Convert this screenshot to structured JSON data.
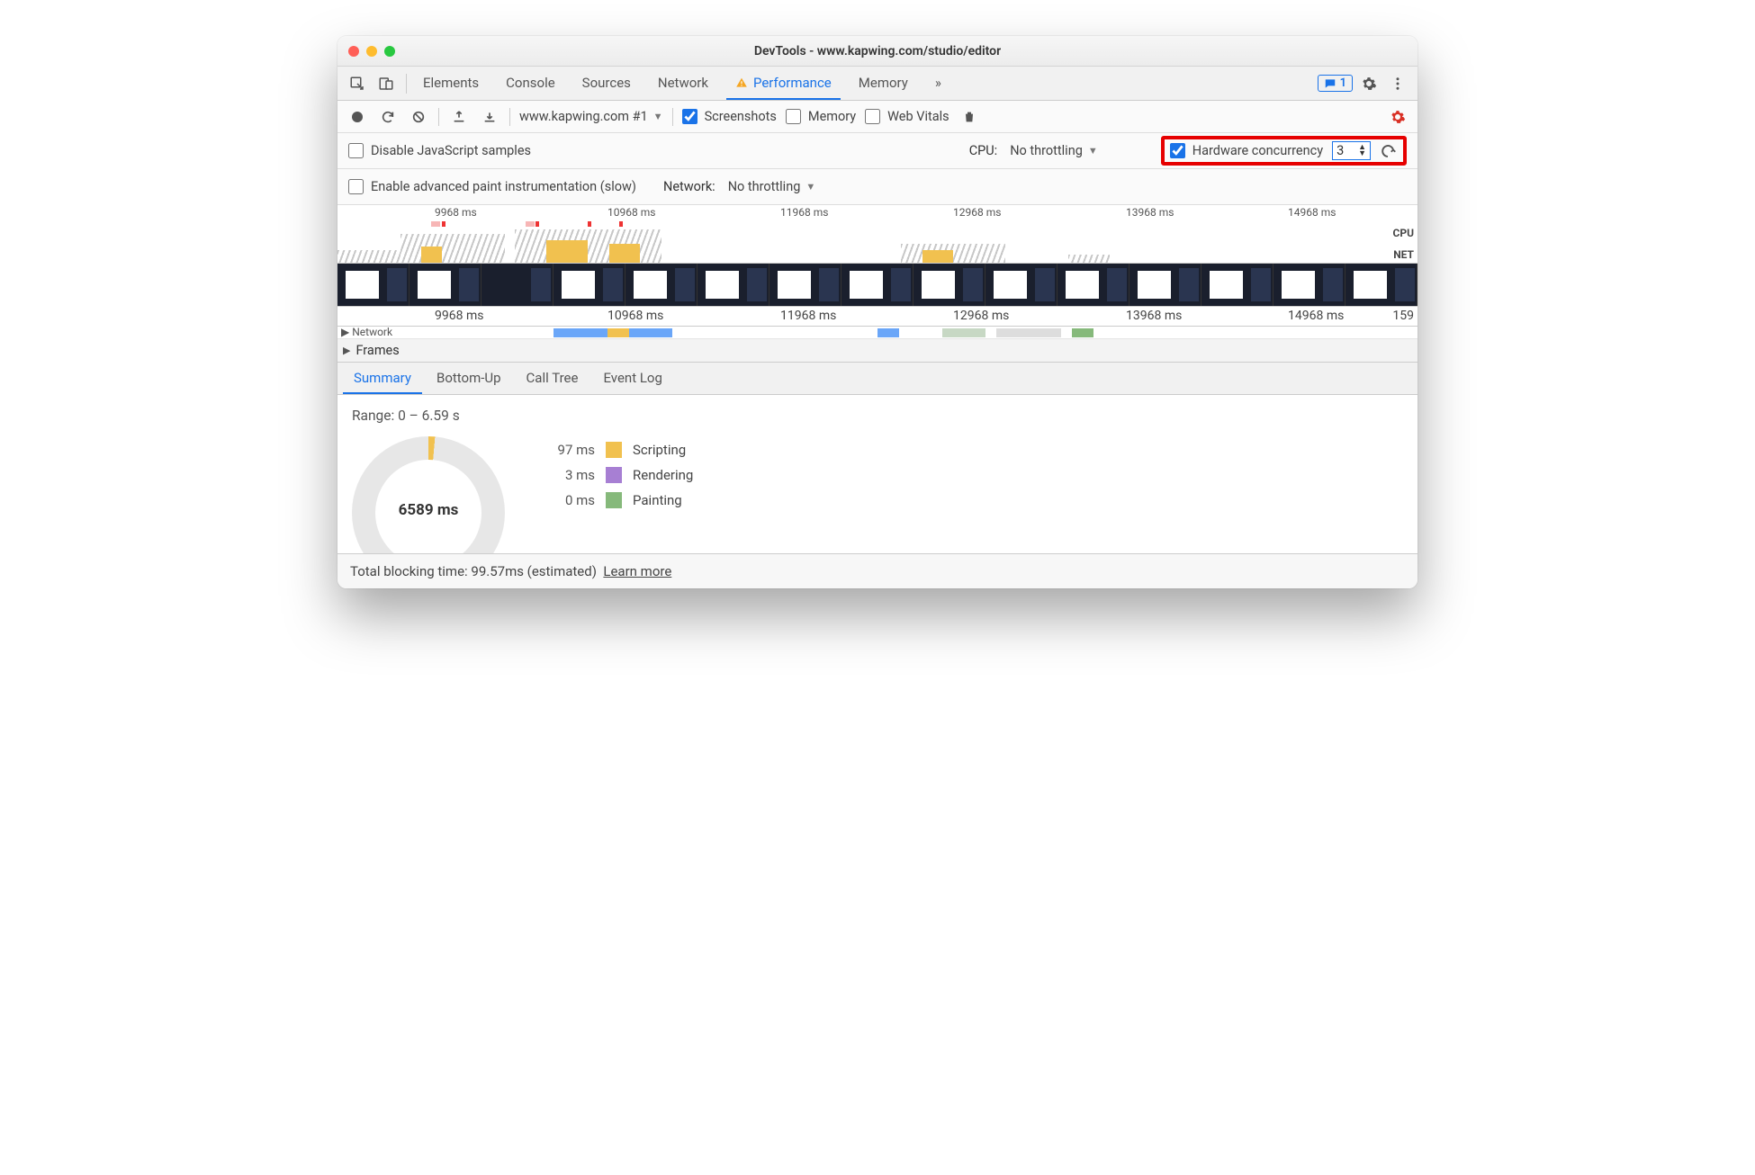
{
  "window": {
    "title": "DevTools - www.kapwing.com/studio/editor"
  },
  "tabs": {
    "items": [
      "Elements",
      "Console",
      "Sources",
      "Network",
      "Performance",
      "Memory"
    ],
    "active": "Performance",
    "warning_on": "Performance"
  },
  "tabbar": {
    "feedback_count": "1"
  },
  "toolbar": {
    "target": "www.kapwing.com #1",
    "screenshots": {
      "label": "Screenshots",
      "checked": true
    },
    "memory": {
      "label": "Memory",
      "checked": false
    },
    "web_vitals": {
      "label": "Web Vitals",
      "checked": false
    }
  },
  "options_row1": {
    "disable_js_samples": {
      "label": "Disable JavaScript samples",
      "checked": false
    },
    "cpu_label": "CPU:",
    "cpu_value": "No throttling",
    "hw_concurrency": {
      "label": "Hardware concurrency",
      "checked": true,
      "value": "3"
    }
  },
  "options_row2": {
    "adv_paint": {
      "label": "Enable advanced paint instrumentation (slow)",
      "checked": false
    },
    "net_label": "Network:",
    "net_value": "No throttling"
  },
  "ruler_marks": [
    "9968 ms",
    "10968 ms",
    "11968 ms",
    "12968 ms",
    "13968 ms",
    "14968 ms"
  ],
  "ruler2_marks": [
    "9968 ms",
    "10968 ms",
    "11968 ms",
    "12968 ms",
    "13968 ms",
    "14968 ms",
    "159"
  ],
  "side_labels": {
    "cpu": "CPU",
    "net": "NET"
  },
  "track_network_label": "Network",
  "frames_label": "Frames",
  "summary_tabs": [
    "Summary",
    "Bottom-Up",
    "Call Tree",
    "Event Log"
  ],
  "summary_active": "Summary",
  "summary": {
    "range": "Range: 0 – 6.59 s",
    "total": "6589 ms",
    "categories": [
      {
        "ms": "97 ms",
        "label": "Scripting",
        "color": "#f1c14f"
      },
      {
        "ms": "3 ms",
        "label": "Rendering",
        "color": "#a77fd3"
      },
      {
        "ms": "0 ms",
        "label": "Painting",
        "color": "#86b97b"
      }
    ]
  },
  "footer": {
    "tbt_prefix": "Total blocking time: ",
    "tbt_value": "99.57ms (estimated)",
    "learn_more": "Learn more"
  }
}
